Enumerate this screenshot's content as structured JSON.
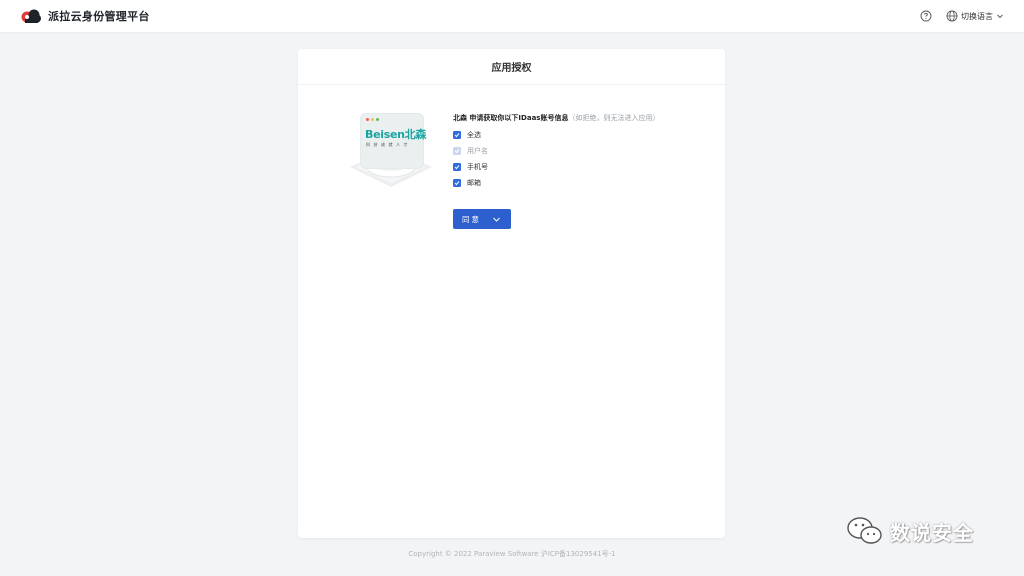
{
  "header": {
    "brand_title": "派拉云身份管理平台",
    "help_icon": "question-circle-icon",
    "language_label": "切换语言",
    "language_icon": "globe-icon"
  },
  "card": {
    "title": "应用授权",
    "app": {
      "logo_text": "Beisen北森",
      "tagline": "科技成就人才"
    },
    "permission": {
      "app_name": "北森",
      "request_text": " 申请获取你以下IDaas账号信息",
      "note": "（如拒绝，则无法进入应用）",
      "options": [
        {
          "label": "全选",
          "checked": true,
          "disabled": false
        },
        {
          "label": "用户名",
          "checked": true,
          "disabled": true
        },
        {
          "label": "手机号",
          "checked": true,
          "disabled": false
        },
        {
          "label": "邮箱",
          "checked": true,
          "disabled": false
        }
      ]
    },
    "agree_button": {
      "label": "同意",
      "icon": "chevron-down-icon"
    }
  },
  "footer": {
    "copyright": "Copyright © 2022 Paraview Software 沪ICP备13029541号-1"
  },
  "watermark": {
    "text": "数说安全",
    "icon": "wechat-icon"
  },
  "colors": {
    "accent": "#2e5fce",
    "checkbox": "#2f6bdf",
    "brand_logo": "#e03a3a",
    "beisen_teal": "#1aa3a0"
  }
}
